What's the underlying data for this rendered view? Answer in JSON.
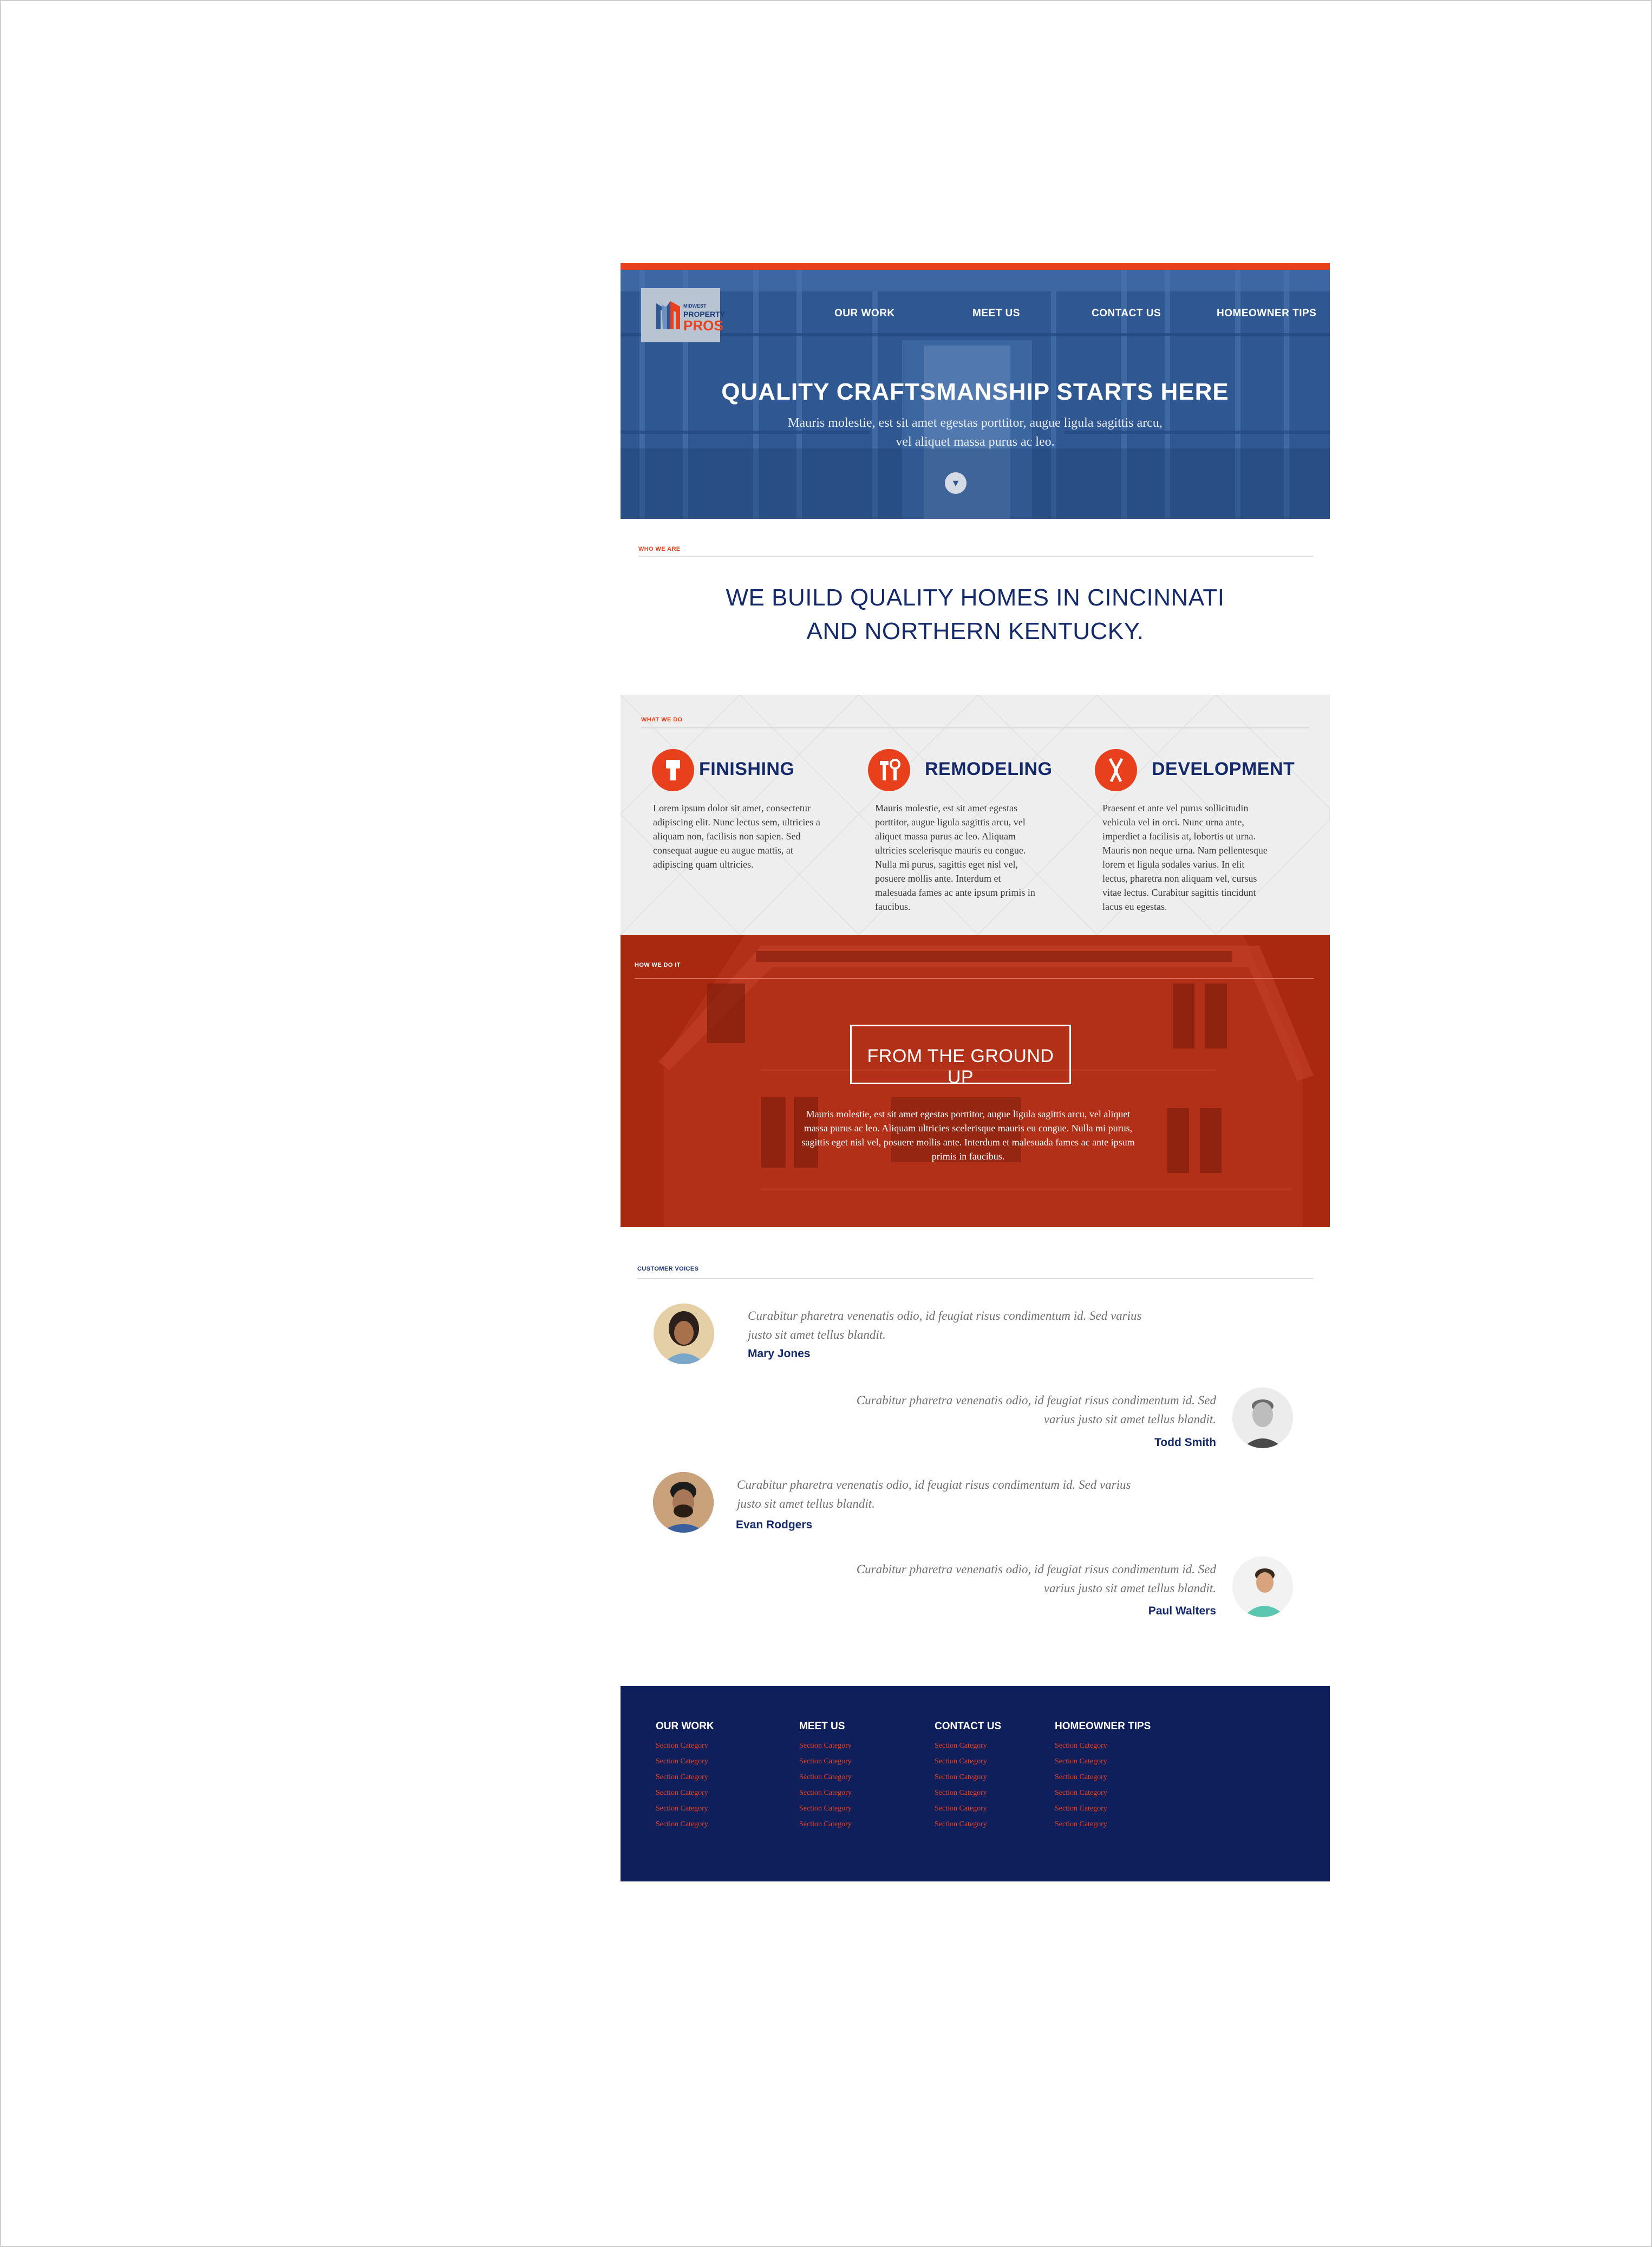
{
  "logo": {
    "small": "MIDWEST",
    "mid": "PROPERTY",
    "big": "PROS"
  },
  "nav": [
    {
      "label": "OUR WORK"
    },
    {
      "label": "MEET US"
    },
    {
      "label": "CONTACT US"
    },
    {
      "label": "HOMEOWNER TIPS"
    }
  ],
  "hero": {
    "title": "QUALITY CRAFTSMANSHIP STARTS HERE",
    "subtitle": "Mauris molestie, est sit amet egestas porttitor, augue ligula sagittis arcu, vel aliquet massa purus ac leo.",
    "scroll_glyph": "▼"
  },
  "who": {
    "label": "WHO WE ARE",
    "heading": "WE BUILD QUALITY HOMES IN CINCINNATI AND NORTHERN KENTUCKY."
  },
  "what": {
    "label": "WHAT WE DO",
    "services": [
      {
        "title": "FINISHING",
        "icon": "paint-brush-icon",
        "text": "Lorem ipsum dolor sit amet, consectetur adipiscing elit. Nunc lectus sem, ultricies a aliquam non, facilisis non sapien. Sed consequat augue eu augue mattis, at adipiscing quam ultricies."
      },
      {
        "title": "REMODELING",
        "icon": "tools-icon",
        "text": "Mauris molestie, est sit amet egestas porttitor, augue ligula sagittis arcu, vel aliquet massa purus ac leo. Aliquam ultricies scelerisque mauris eu congue. Nulla mi purus, sagittis eget nisl vel, posuere mollis ante. Interdum et malesuada fames ac ante ipsum primis in faucibus."
      },
      {
        "title": "DEVELOPMENT",
        "icon": "pliers-icon",
        "text": "Praesent et ante vel purus sollicitudin vehicula vel in orci. Nunc urna ante, imperdiet a facilisis at, lobortis ut urna. Mauris non neque urna. Nam pellentesque lorem et ligula sodales varius. In elit lectus, pharetra non aliquam vel, cursus vitae lectus. Curabitur sagittis tincidunt lacus eu egestas."
      }
    ]
  },
  "how": {
    "label": "HOW WE DO IT",
    "heading": "FROM THE GROUND UP",
    "text": "Mauris molestie, est sit amet egestas porttitor, augue ligula sagittis arcu, vel aliquet massa purus ac leo. Aliquam ultricies scelerisque mauris eu congue. Nulla mi purus, sagittis eget nisl vel, posuere mollis ante. Interdum et malesuada fames ac ante ipsum primis in faucibus."
  },
  "voices": {
    "label": "CUSTOMER VOICES",
    "testimonials": [
      {
        "quote": "Curabitur pharetra venenatis odio, id feugiat risus condimentum id. Sed varius justo sit amet tellus blandit.",
        "name": "Mary Jones"
      },
      {
        "quote": "Curabitur pharetra venenatis odio, id feugiat risus condimentum id. Sed varius justo sit amet tellus blandit.",
        "name": "Todd Smith"
      },
      {
        "quote": "Curabitur pharetra venenatis odio, id feugiat risus condimentum id. Sed varius justo sit amet tellus blandit.",
        "name": "Evan Rodgers"
      },
      {
        "quote": "Curabitur pharetra venenatis odio, id feugiat risus condimentum id. Sed varius justo sit amet tellus blandit.",
        "name": "Paul Walters"
      }
    ]
  },
  "footer": {
    "columns": [
      {
        "heading": "OUR WORK",
        "links": [
          "Section Category",
          "Section Category",
          "Section Category",
          "Section Category",
          "Section Category",
          "Section Category"
        ]
      },
      {
        "heading": "MEET US",
        "links": [
          "Section Category",
          "Section Category",
          "Section Category",
          "Section Category",
          "Section Category",
          "Section Category"
        ]
      },
      {
        "heading": "CONTACT US",
        "links": [
          "Section Category",
          "Section Category",
          "Section Category",
          "Section Category",
          "Section Category",
          "Section Category"
        ]
      },
      {
        "heading": "HOMEOWNER TIPS",
        "links": [
          "Section Category",
          "Section Category",
          "Section Category",
          "Section Category",
          "Section Category",
          "Section Category"
        ]
      }
    ]
  },
  "colors": {
    "accent": "#e8401c",
    "navy": "#152a6b",
    "hero_blue": "#2f5791",
    "how_red": "#a82810",
    "footer_navy": "#0f1f5c"
  }
}
